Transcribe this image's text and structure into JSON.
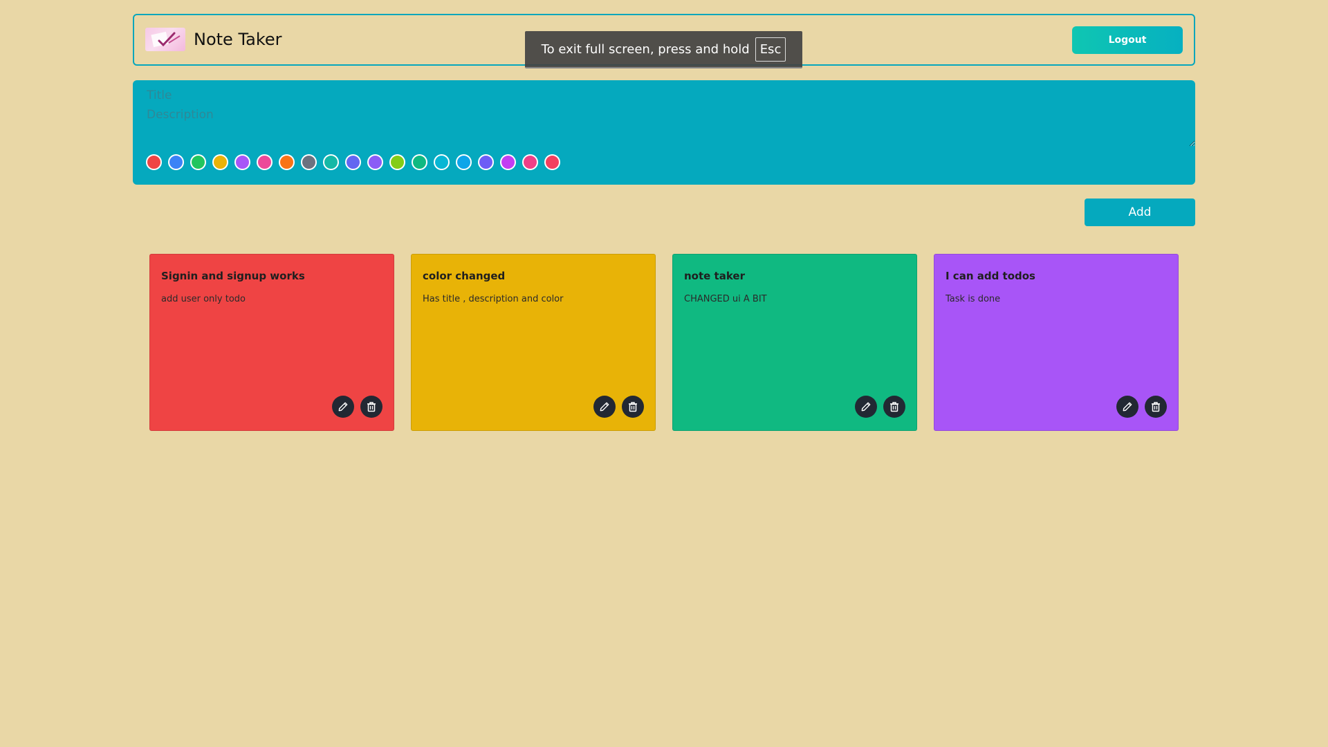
{
  "header": {
    "app_title": "Note Taker",
    "logout_label": "Logout"
  },
  "fullscreen_toast": {
    "message": "To exit full screen, press and hold",
    "key": "Esc"
  },
  "composer": {
    "title_placeholder": "Title",
    "description_placeholder": "Description",
    "colors": [
      "#ef4444",
      "#3b82f6",
      "#22c55e",
      "#eab308",
      "#a855f7",
      "#ec4899",
      "#f97316",
      "#6b7280",
      "#14b8a6",
      "#6366f1",
      "#8b5cf6",
      "#84cc16",
      "#10b981",
      "#06b6d4",
      "#0ea5e9",
      "#6d5df6",
      "#c23ef2",
      "#ee3f87",
      "#f43f5e"
    ]
  },
  "add_label": "Add",
  "notes": [
    {
      "title": "Signin and signup works",
      "description": "add user only todo",
      "color": "#ef4444"
    },
    {
      "title": "color changed",
      "description": "Has title , description and color",
      "color": "#e8b307"
    },
    {
      "title": "note taker",
      "description": "CHANGED ui A BIT",
      "color": "#10b981"
    },
    {
      "title": "I can add todos",
      "description": "Task is done",
      "color": "#a855f7"
    }
  ],
  "icons": {
    "edit": "pencil-icon",
    "delete": "trash-icon"
  }
}
